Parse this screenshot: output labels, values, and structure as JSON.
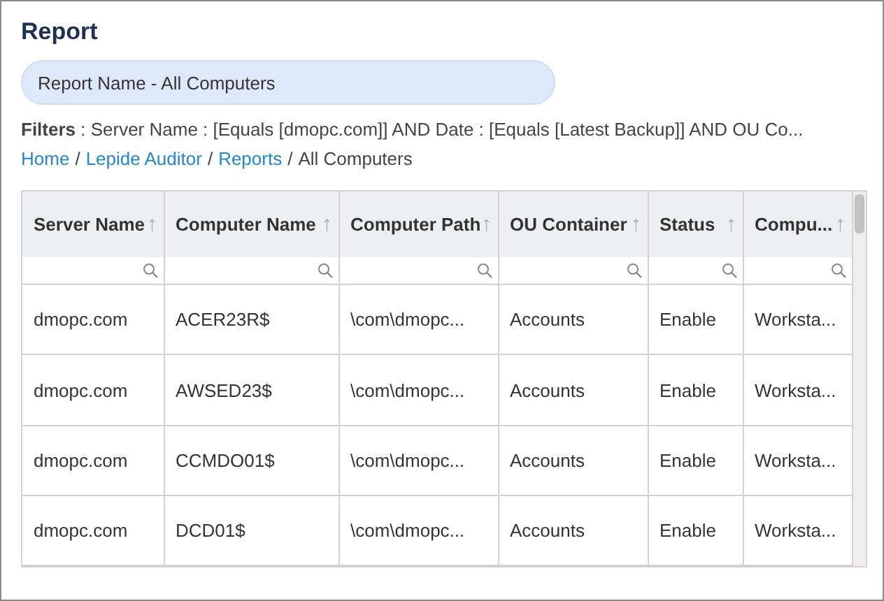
{
  "title": "Report",
  "report_name": "Report Name - All Computers",
  "filters": "**Filters** : Server Name : [Equals [dmopc.com]] AND Date : [Equals [Latest Backup]] AND OU Co...",
  "breadcrumb": {
    "separator": "/",
    "items": [
      {
        "label": "Home",
        "kind": "link"
      },
      {
        "label": "Lepide Auditor",
        "kind": "link"
      },
      {
        "label": "Reports",
        "kind": "link"
      },
      {
        "label": "All Computers",
        "kind": "current"
      }
    ]
  },
  "table": {
    "columns": [
      {
        "label": "Server Name",
        "sort_icon": "↑"
      },
      {
        "label": "Computer Name",
        "sort_icon": "↑"
      },
      {
        "label": "Computer Path",
        "sort_icon": "↑"
      },
      {
        "label": "OU Container",
        "sort_icon": "↑"
      },
      {
        "label": "Status",
        "sort_icon": "↑"
      },
      {
        "label": "Compu...",
        "sort_icon": "↑"
      }
    ],
    "rows": [
      [
        "dmopc.com",
        "ACER23R$",
        "\\com\\dmopc...",
        "Accounts",
        "Enable",
        "Worksta..."
      ],
      [
        "dmopc.com",
        "AWSED23$",
        "\\com\\dmopc...",
        "Accounts",
        "Enable",
        "Worksta..."
      ],
      [
        "dmopc.com",
        "CCMDO01$",
        "\\com\\dmopc...",
        "Accounts",
        "Enable",
        "Worksta..."
      ],
      [
        "dmopc.com",
        "DCD01$",
        "\\com\\dmopc...",
        "Accounts",
        "Enable",
        "Worksta..."
      ]
    ]
  }
}
